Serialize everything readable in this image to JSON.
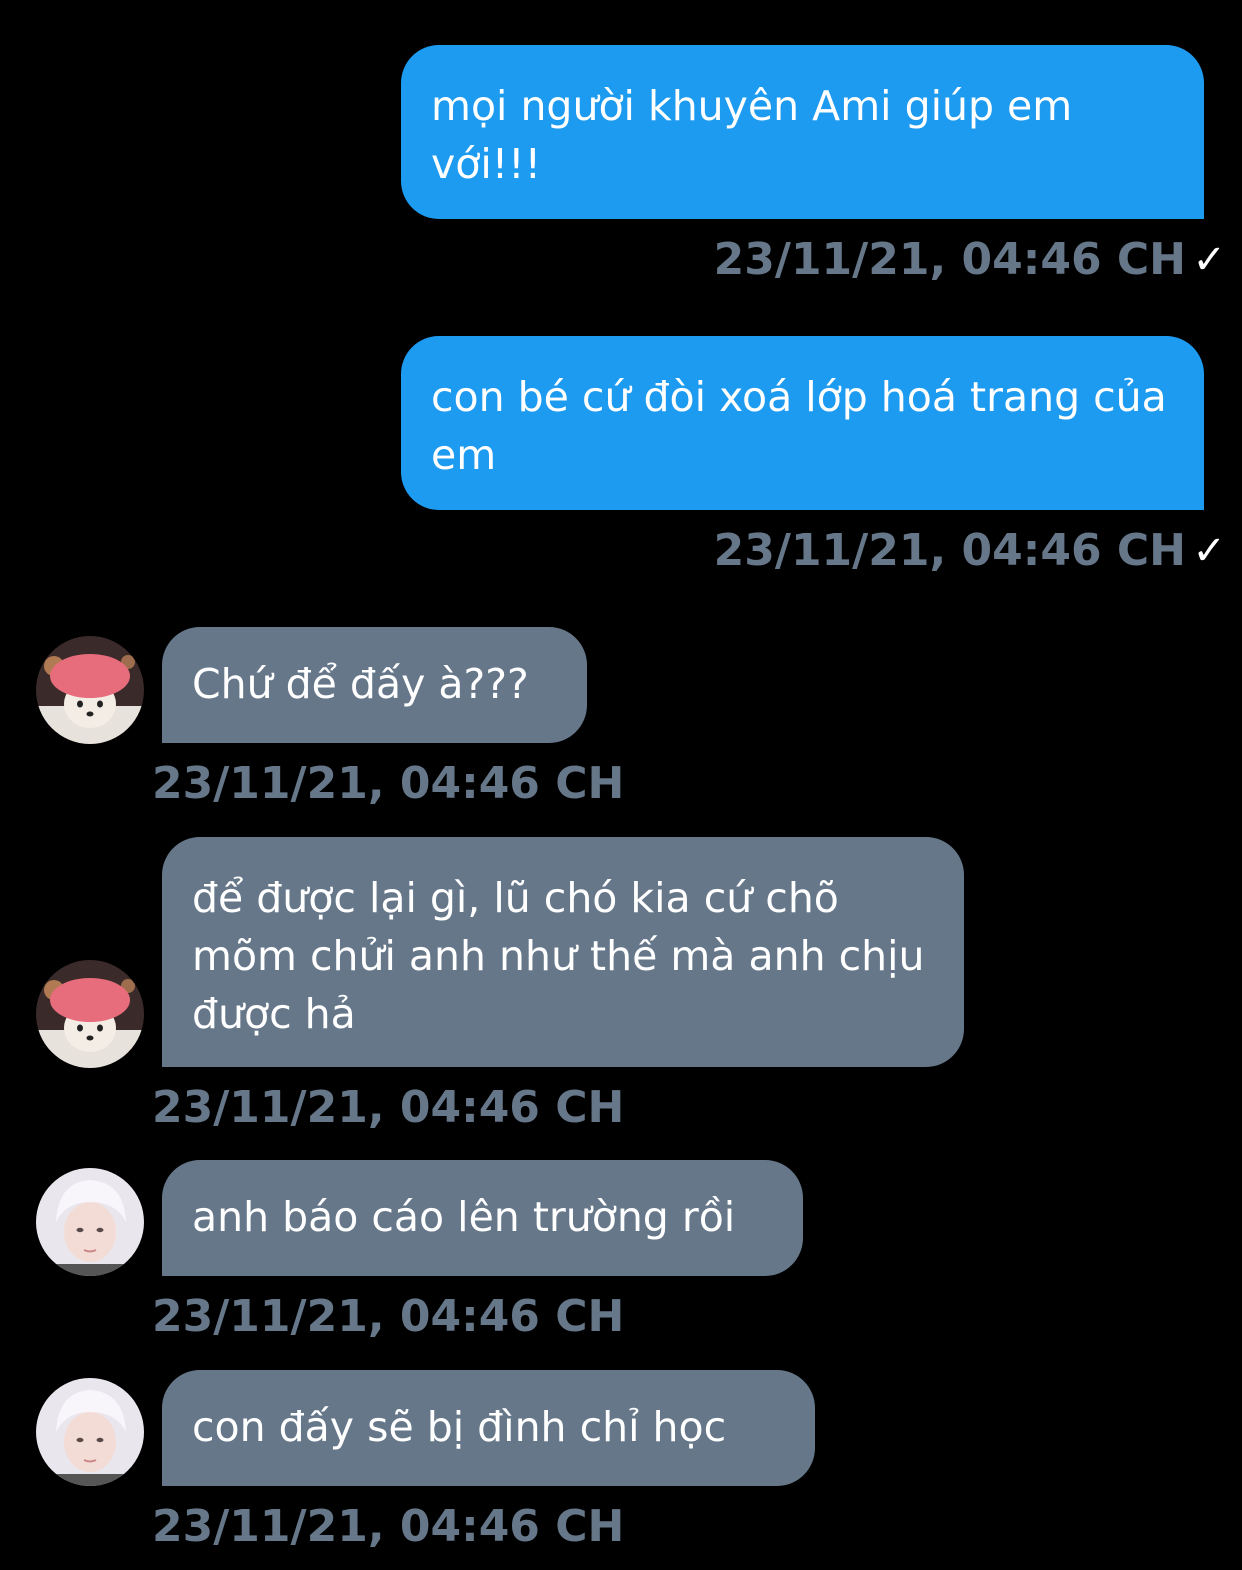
{
  "messages": [
    {
      "direction": "out",
      "text": "mọi người khuyên Ami giúp em với!!!",
      "timestamp": "23/11/21, 04:46 CH",
      "status_icon": "checkmark-icon",
      "status_glyph": "✓"
    },
    {
      "direction": "out",
      "text": "con bé cứ đòi xoá lớp hoá trang của em",
      "timestamp": "23/11/21, 04:46 CH",
      "status_icon": "checkmark-icon",
      "status_glyph": "✓"
    },
    {
      "direction": "in",
      "avatar": "dog-avatar",
      "text": "Chứ để đấy à???",
      "timestamp": "23/11/21, 04:46 CH"
    },
    {
      "direction": "in",
      "avatar": "dog-avatar",
      "text": "để được lại gì, lũ chó kia cứ chõ mõm chửi anh như thế mà anh chịu được hả",
      "timestamp": "23/11/21, 04:46 CH"
    },
    {
      "direction": "in",
      "avatar": "person-avatar",
      "text": "anh báo cáo lên trường rồi",
      "timestamp": "23/11/21, 04:46 CH"
    },
    {
      "direction": "in",
      "avatar": "person-avatar",
      "text": "con đấy sẽ bị đình chỉ học",
      "timestamp": "23/11/21, 04:46 CH"
    }
  ],
  "colors": {
    "background": "#000000",
    "outgoing_bubble": "#1d9bf0",
    "incoming_bubble": "#66778a",
    "timestamp": "#66778a"
  }
}
